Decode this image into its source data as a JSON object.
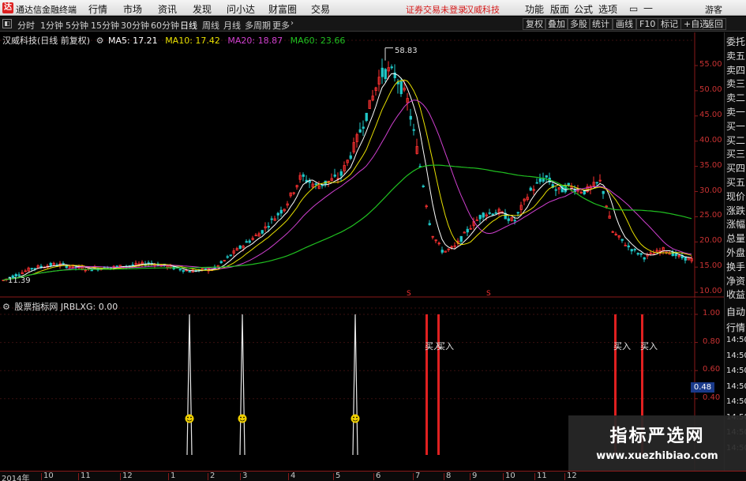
{
  "app": {
    "title": "通达信金融终端",
    "menus": [
      "行情",
      "市场",
      "资讯",
      "发现",
      "问小达",
      "财富圈",
      "交易"
    ],
    "alert": "证券交易未登录",
    "stock_name": "汉威科技",
    "right_menus": [
      "功能",
      "版面",
      "公式",
      "选项"
    ],
    "guest": "游客"
  },
  "periods": {
    "items": [
      "分时",
      "1分钟",
      "5分钟",
      "15分钟",
      "30分钟",
      "60分钟",
      "日线",
      "周线",
      "月线",
      "多周期",
      "更多"
    ],
    "active": "日线"
  },
  "toolbar_right": [
    "复权",
    "叠加",
    "多股",
    "统计",
    "画线",
    "F10",
    "标记",
    "+自选",
    "返回"
  ],
  "main_chart": {
    "title": "汉威科技(日线 前复权)",
    "legend": [
      {
        "text": "MA5: 17.21",
        "color": "#ffffff"
      },
      {
        "text": "MA10: 17.42",
        "color": "#e8e000"
      },
      {
        "text": "MA20: 18.87",
        "color": "#d040d0"
      },
      {
        "text": "MA60: 23.66",
        "color": "#20c020"
      }
    ],
    "high_label": "58.83",
    "low_label": "11.39",
    "marker": "S",
    "y_ticks": [
      "55.00",
      "50.00",
      "45.00",
      "40.00",
      "35.00",
      "30.00",
      "25.00",
      "20.00",
      "15.00",
      "10.00"
    ]
  },
  "indicator": {
    "title": "股票指标网 JRBLXG: 0.00",
    "buy_label": "买入",
    "y_ticks": [
      "1.00",
      "0.80",
      "0.60",
      "0.40"
    ],
    "current_value": "0.48"
  },
  "x_axis": [
    "2014年",
    "10",
    "11",
    "12",
    "1",
    "2",
    "3",
    "4",
    "5",
    "6",
    "7",
    "8",
    "9",
    "10",
    "11",
    "12"
  ],
  "side_panel": [
    "委托",
    "卖五",
    "卖四",
    "卖三",
    "卖二",
    "卖一",
    "买一",
    "买二",
    "买三",
    "买四",
    "买五",
    "现价",
    "涨跌",
    "涨幅",
    "总量",
    "外盘",
    "换手",
    "净资",
    "收益"
  ],
  "side_panel2": [
    "自动",
    "行情",
    "14:50",
    "14:50",
    "14:50",
    "14:50",
    "14:50",
    "14:50",
    "14:50",
    "14:50"
  ],
  "watermark": {
    "line1": "指标严选网",
    "line2": "www.xuezhibiao.com"
  },
  "colors": {
    "up": "#ff3232",
    "down": "#20c8c8",
    "buy_bar": "#e02020",
    "signal": "#e8e8e8",
    "smile": "#f0d000",
    "ma60": "#20c020"
  }
}
